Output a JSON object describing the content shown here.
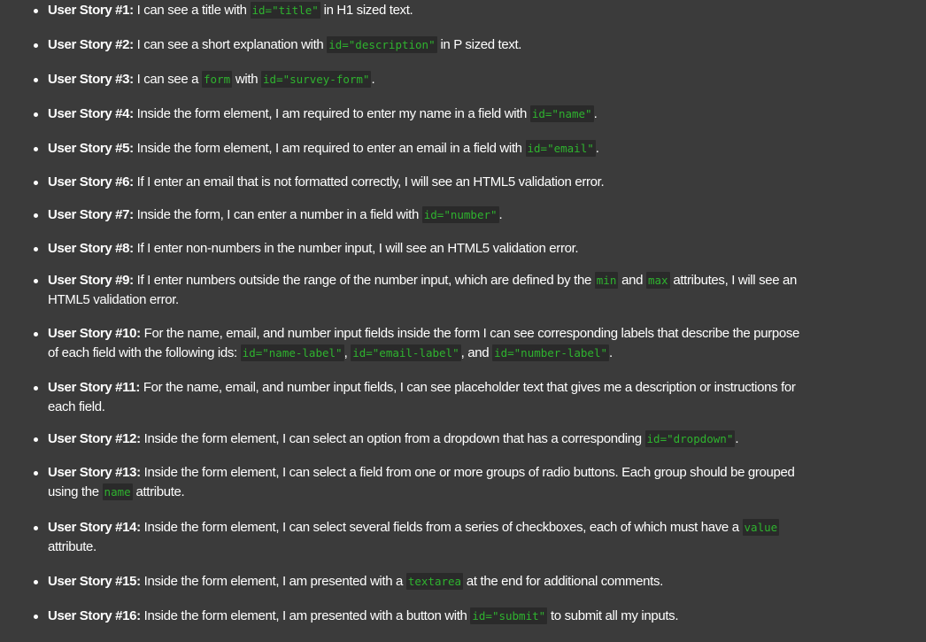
{
  "stories": [
    {
      "label": "User Story #1:",
      "p": [
        "I can see a title with ",
        "id=\"title\"",
        " in H1 sized text."
      ]
    },
    {
      "label": "User Story #2:",
      "p": [
        "I can see a short explanation with ",
        "id=\"description\"",
        " in P sized text."
      ]
    },
    {
      "label": "User Story #3:",
      "p": [
        "I can see a ",
        "form",
        " with ",
        "id=\"survey-form\"",
        "."
      ]
    },
    {
      "label": "User Story #4:",
      "p": [
        "Inside the form element, I am required to enter my name in a field with ",
        "id=\"name\"",
        "."
      ]
    },
    {
      "label": "User Story #5:",
      "p": [
        "Inside the form element, I am required to enter an email in a field with ",
        "id=\"email\"",
        "."
      ]
    },
    {
      "label": "User Story #6:",
      "p": [
        "If I enter an email that is not formatted correctly, I will see an HTML5 validation error."
      ]
    },
    {
      "label": "User Story #7:",
      "p": [
        "Inside the form, I can enter a number in a field with ",
        "id=\"number\"",
        "."
      ]
    },
    {
      "label": "User Story #8:",
      "p": [
        "If I enter non-numbers in the number input, I will see an HTML5 validation error."
      ]
    },
    {
      "label": "User Story #9:",
      "p": [
        "If I enter numbers outside the range of the number input, which are defined by the ",
        "min",
        " and ",
        "max",
        " attributes, I will see an",
        "HTML5 validation error."
      ]
    },
    {
      "label": "User Story #10:",
      "p": [
        "For the name, email, and number input fields inside the form I can see corresponding labels that describe the purpose",
        "of each field with the following ids: ",
        "id=\"name-label\"",
        ", ",
        "id=\"email-label\"",
        ", and ",
        "id=\"number-label\"",
        "."
      ]
    },
    {
      "label": "User Story #11:",
      "p": [
        "For the name, email, and number input fields, I can see placeholder text that gives me a description or instructions for",
        "each field."
      ]
    },
    {
      "label": "User Story #12:",
      "p": [
        "Inside the form element, I can select an option from a dropdown that has a corresponding ",
        "id=\"dropdown\"",
        "."
      ]
    },
    {
      "label": "User Story #13:",
      "p": [
        "Inside the form element, I can select a field from one or more groups of radio buttons. Each group should be grouped",
        "using the ",
        "name",
        " attribute."
      ]
    },
    {
      "label": "User Story #14:",
      "p": [
        "Inside the form element, I can select several fields from a series of checkboxes, each of which must have a ",
        "value",
        "attribute."
      ]
    },
    {
      "label": "User Story #15:",
      "p": [
        "Inside the form element, I am presented with a ",
        "textarea",
        " at the end for additional comments."
      ]
    },
    {
      "label": "User Story #16:",
      "p": [
        "Inside the form element, I am presented with a button with ",
        "id=\"submit\"",
        " to submit all my inputs."
      ]
    }
  ]
}
